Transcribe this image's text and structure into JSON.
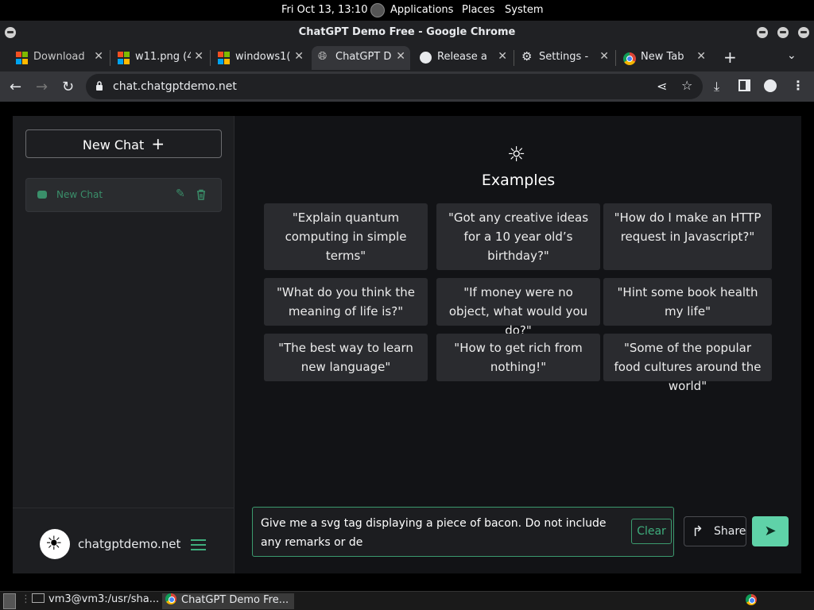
{
  "top_panel": {
    "clock": "Fri Oct 13, 13:10",
    "menus": [
      "Applications",
      "Places",
      "System"
    ]
  },
  "window": {
    "title": "ChatGPT Demo Free - Google Chrome"
  },
  "tabs": [
    {
      "label": "Download",
      "icon": "windows-logo"
    },
    {
      "label": "w11.png (4",
      "icon": "windows-logo"
    },
    {
      "label": "windows1(",
      "icon": "windows-logo"
    },
    {
      "label": "ChatGPT D",
      "icon": "globe-icon",
      "active": true
    },
    {
      "label": "Release a",
      "icon": "github-icon"
    },
    {
      "label": "Settings -",
      "icon": "gear-icon"
    },
    {
      "label": "New Tab",
      "icon": "chrome-icon"
    }
  ],
  "address_bar": {
    "url": "chat.chatgptdemo.net"
  },
  "sidebar": {
    "new_chat_label": "New Chat",
    "chats": [
      {
        "label": "New Chat"
      }
    ],
    "site_name": "chatgptdemo.net"
  },
  "main": {
    "examples_title": "Examples",
    "examples": [
      "\"Explain quantum computing in simple terms\"",
      "\"Got any creative ideas for a 10 year old’s birthday?\"",
      "\"How do I make an HTTP request in Javascript?\"",
      "\"What do you think the meaning of life is?\"",
      "\"If money were no object, what would you do?\"",
      "\"Hint some book health my life\"",
      "\"The best way to learn new language\"",
      "\"How to get rich from nothing!\"",
      "\"Some of the popular food cultures around the world\""
    ],
    "input_value": "Give me a svg tag displaying a piece of bacon. Do not include any remarks or de",
    "clear_label": "Clear",
    "share_label": "Share"
  },
  "taskbar": {
    "items": [
      {
        "label": "vm3@vm3:/usr/sha..."
      },
      {
        "label": "ChatGPT Demo Fre..."
      }
    ]
  },
  "colors": {
    "accent": "#3fae7d",
    "send_button": "#5fd2a8",
    "page_bg": "#121316",
    "sidebar_bg": "#1d1e21",
    "card_bg": "#2a2b2f"
  }
}
